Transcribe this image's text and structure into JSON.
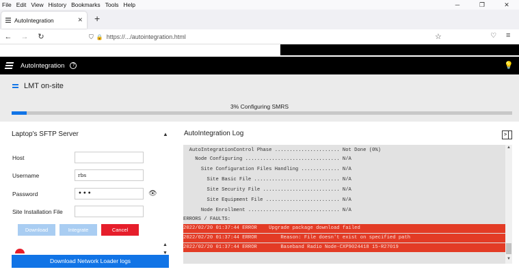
{
  "browser": {
    "menu": [
      "File",
      "Edit",
      "View",
      "History",
      "Bookmarks",
      "Tools",
      "Help"
    ],
    "tab_title": "AutoIntegration",
    "url": "https://.../autointegration.html"
  },
  "app": {
    "title": "AutoIntegration",
    "section_title": "LMT on-site",
    "progress": {
      "label": "3% Configuring SMRS",
      "percent": 3
    },
    "sftp": {
      "title": "Laptop's SFTP Server",
      "fields": [
        {
          "label": "Host",
          "value": ""
        },
        {
          "label": "Username",
          "value": "rbs"
        },
        {
          "label": "Password",
          "value": "•••"
        },
        {
          "label": "Site Installation File",
          "value": ""
        }
      ],
      "buttons": {
        "download": "Download",
        "integrate": "Integrate",
        "cancel": "Cancel"
      },
      "network_loader_button": "Download Network Loader logs"
    },
    "log": {
      "title": "AutoIntegration Log",
      "lines": [
        {
          "text": "  AutoIntegrationControl Phase ...................... Not Done (0%)",
          "error": false
        },
        {
          "text": "    Node Configuring ................................ N/A",
          "error": false
        },
        {
          "text": "      Site Configuration Files Handling ............. N/A",
          "error": false
        },
        {
          "text": "        Site Basic File ............................. N/A",
          "error": false
        },
        {
          "text": "        Site Security File .......................... N/A",
          "error": false
        },
        {
          "text": "        Site Equipment File ......................... N/A",
          "error": false
        },
        {
          "text": "      Node Enrollment ............................... N/A",
          "error": false
        },
        {
          "text": "ERRORS / FAULTS:",
          "error": false
        },
        {
          "text": "2022/02/20 01:37:44 ERROR    Upgrade package download failed",
          "error": true
        },
        {
          "text": "2022/02/20 01:37:44 ERROR        Reason: File doesn't exist on specified path",
          "error": true
        },
        {
          "text": "2022/02/20 01:37:44 ERROR        Baseband Radio Node-CXP9024418 15-R27019",
          "error": true
        }
      ]
    }
  }
}
